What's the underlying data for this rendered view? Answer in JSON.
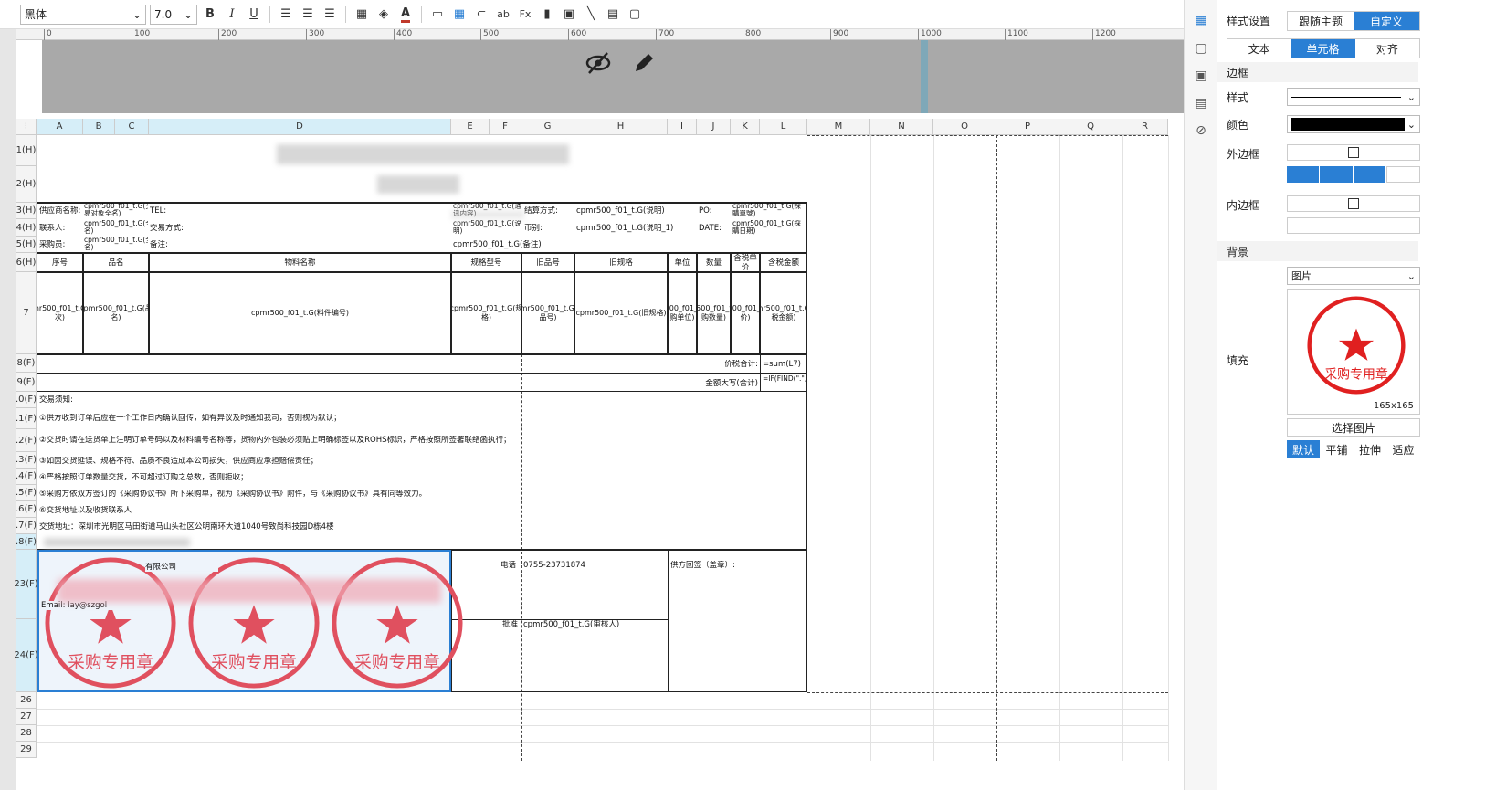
{
  "toolbar": {
    "font_name": "黑体",
    "font_size": "7.0",
    "font_color": "#c0392b"
  },
  "ruler": {
    "marks": [
      "0",
      "100",
      "200",
      "300",
      "400",
      "500",
      "600",
      "700",
      "800",
      "900",
      "1000",
      "1100",
      "1200"
    ]
  },
  "columns": [
    "A",
    "B",
    "C",
    "D",
    "E",
    "F",
    "G",
    "H",
    "I",
    "J",
    "K",
    "L",
    "M",
    "N",
    "O",
    "P",
    "Q",
    "R"
  ],
  "rows": [
    "1(H)",
    "2(H)",
    "3(H)",
    "4(H)",
    "5(H)",
    "6(H)",
    "7",
    "8(F)",
    "9(F)",
    ".0(F)",
    ".1(F)",
    ".2(F)",
    ".3(F)",
    ".4(F)",
    ".5(F)",
    ".6(F)",
    ".7(F)",
    ".8(F)",
    "23(F)",
    "24(F)",
    "26",
    "27",
    "28",
    "29"
  ],
  "sheet": {
    "r3_a": "供应商名称:",
    "r3_b": "cpmr500_f01_t.G(交易对象全名)",
    "r3_c": "TEL:",
    "r3_e": "cpmr500_f01_t.G(通讯内容)",
    "r3_g": "结算方式:",
    "r3_h": "cpmr500_f01_t.G(说明)",
    "r3_k": "PO:",
    "r3_l": "cpmr500_f01_t.G(採購單號)",
    "r4_a": "联系人:",
    "r4_b": "cpmr500_f01_t.G(全名)",
    "r4_c": "交易方式:",
    "r4_e": "cpmr500_f01_t.G(说明)",
    "r4_g": "币别:",
    "r4_h": "cpmr500_f01_t.G(说明_1)",
    "r4_k": "DATE:",
    "r4_l": "cpmr500_f01_t.G(採購日期)",
    "r5_a": "采购员:",
    "r5_b": "cpmr500_f01_t.G(全名)",
    "r5_c": "备注:",
    "r5_e": "cpmr500_f01_t.G(备注)",
    "h_seq": "序号",
    "h_pin": "品名",
    "h_mat": "物料名称",
    "h_spec": "规格型号",
    "h_old": "旧品号",
    "h_oldspec": "旧规格",
    "h_unit": "单位",
    "h_qty": "数量",
    "h_price": "含税单价",
    "h_amt": "含税金额",
    "d_seq": "cpmr500_f01_t.G(项次)",
    "d_pin": "cpmr500_f01_t.G(品名)",
    "d_mat": "cpmr500_f01_t.G(料件编号)",
    "d_spec": "cpmr500_f01_t.G(规格)",
    "d_old": "cpmr500_f01_t.G(旧品号)",
    "d_oldspec": "cpmr500_f01_t.G(旧规格)",
    "d_unit": "cpmr500_f01_t.G(采购单位)",
    "d_qty": "cpmr500_f01_t.G(采购数量)",
    "d_price": "cpmr500_f01_t.G(单价)",
    "d_amt": "cpmr500_f01_t.G(含税金额)",
    "r8_label": "价税合计:",
    "r8_val": "=sum(L7)",
    "r9_label": "金额大写(合计)",
    "r9_val": "=IF(FIND(\".\",L8)",
    "t0": "交易须知:",
    "t1": "①供方收到订单后应在一个工作日内确认回传，如有异议及时通知我司，否则视为默认；",
    "t2": "②交货时请在送货单上注明订单号码以及材料编号名称等，货物内外包装必须贴上明确标签以及ROHS标识，严格按照所签署联络函执行；",
    "t3": "③如因交货延误、规格不符、品质不良造成本公司损失，供应商应承担赔偿责任；",
    "t4": "④严格按照订单数量交货，不可超过订购之总数，否则拒收；",
    "t5": "⑤采购方依双方签订的《采购协议书》所下采购单，视为《采购协议书》附件，与《采购协议书》具有同等效力。",
    "t6": "⑥交货地址以及收货联系人",
    "t7": "交货地址：深圳市光明区马田街道马山头社区公明南环大道1040号致尚科技园D栋4楼",
    "s_company": "有限公司",
    "s_email": "Email: lay@szgol",
    "s_tel_label": "电话",
    "s_tel_val": "0755-23731874",
    "s_sign": "供方回签（盖章）:",
    "s_approve_label": "批准",
    "s_approve_val": "cpmr500_f01_t.G(审核人)",
    "stamp_text": "采购专用章"
  },
  "panel": {
    "style_setting": "样式设置",
    "follow_theme": "跟随主题",
    "custom": "自定义",
    "tab_text": "文本",
    "tab_cell": "单元格",
    "tab_align": "对齐",
    "border": "边框",
    "style": "样式",
    "color": "颜色",
    "outer_border": "外边框",
    "inner_border": "内边框",
    "background": "背景",
    "bg_type": "图片",
    "fill": "填充",
    "img_size": "165x165",
    "choose_image": "选择图片",
    "fit_default": "默认",
    "fit_tile": "平铺",
    "fit_stretch": "拉伸",
    "fit_fit": "适应",
    "border_color": "#000000",
    "accent": "#2a7fd4"
  }
}
